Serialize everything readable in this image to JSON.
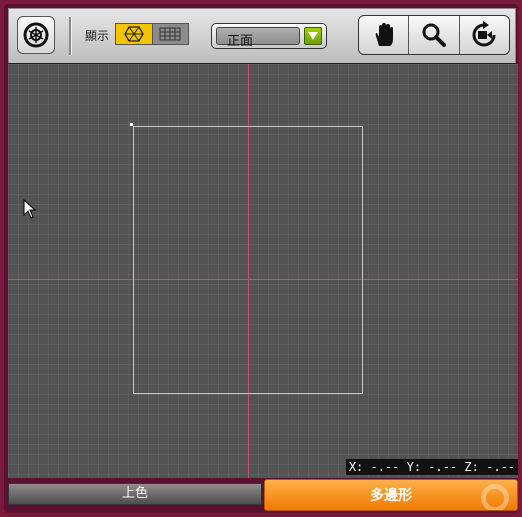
{
  "toolbar": {
    "display_label": "顯示",
    "view_select": {
      "value": "正面"
    }
  },
  "icons": {
    "rotate_reset": "rotate-view-icon",
    "shaded": "shaded-mode-icon",
    "grid": "grid-mode-icon",
    "dropdown": "dropdown-arrow-icon",
    "pan": "hand-pan-icon",
    "zoom": "magnifier-icon",
    "camera": "camera-rotate-icon",
    "cursor": "mouse-cursor-icon"
  },
  "viewport": {
    "coordinate_readout": "X: -.-- Y: -.-- Z: -.--"
  },
  "tabs": {
    "left_label": "上色",
    "right_label": "多邊形"
  },
  "colors": {
    "active_toggle": "#f5c400",
    "dropdown_arrow": "#8fbf00",
    "axis": "#d04c70",
    "active_tab": "#f07a00"
  }
}
